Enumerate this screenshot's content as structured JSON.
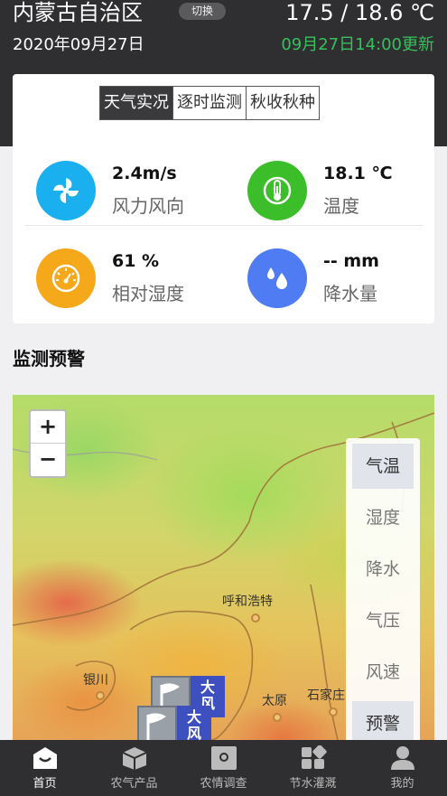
{
  "header": {
    "region": "内蒙古自治区",
    "switch_label": "切换",
    "temp_range": "17.5 / 18.6 ℃",
    "date": "2020年09月27日",
    "update_time": "09月27日14:00更新"
  },
  "tabs": [
    {
      "label": "天气实况",
      "active": true
    },
    {
      "label": "逐时监测",
      "active": false
    },
    {
      "label": "秋收秋种",
      "active": false
    }
  ],
  "metrics": [
    {
      "value": "2.4m/s",
      "label": "风力风向",
      "icon": "fan-icon",
      "color": "#1ab0f0"
    },
    {
      "value": "18.1 ℃",
      "label": "温度",
      "icon": "thermometer-icon",
      "color": "#3cbd2a"
    },
    {
      "value": "61 %",
      "label": "相对湿度",
      "icon": "gauge-icon",
      "color": "#f6a81b"
    },
    {
      "value": "-- mm",
      "label": "降水量",
      "icon": "raindrops-icon",
      "color": "#4f7cf2"
    }
  ],
  "section_title": "监测预警",
  "map": {
    "zoom_in": "+",
    "zoom_out": "−",
    "layers": [
      {
        "label": "气温",
        "active": true
      },
      {
        "label": "湿度",
        "active": false
      },
      {
        "label": "降水",
        "active": false
      },
      {
        "label": "气压",
        "active": false
      },
      {
        "label": "风速",
        "active": false
      },
      {
        "label": "预警",
        "active": true
      }
    ],
    "cities": [
      "呼和浩特",
      "银川",
      "太原",
      "石家庄"
    ],
    "warnings": [
      {
        "line1": "大",
        "line2": "风"
      },
      {
        "line1": "大",
        "line2": "风"
      }
    ]
  },
  "nav": [
    {
      "label": "首页",
      "icon": "home-icon",
      "active": true
    },
    {
      "label": "农气产品",
      "icon": "box-icon",
      "active": false
    },
    {
      "label": "农情调查",
      "icon": "camera-icon",
      "active": false
    },
    {
      "label": "节水灌溉",
      "icon": "grid-icon",
      "active": false
    },
    {
      "label": "我的",
      "icon": "user-icon",
      "active": false
    }
  ],
  "colors": {
    "header_bg": "#2f2f31",
    "update_green": "#36c05a",
    "warning_blue": "#3e4fc0"
  }
}
